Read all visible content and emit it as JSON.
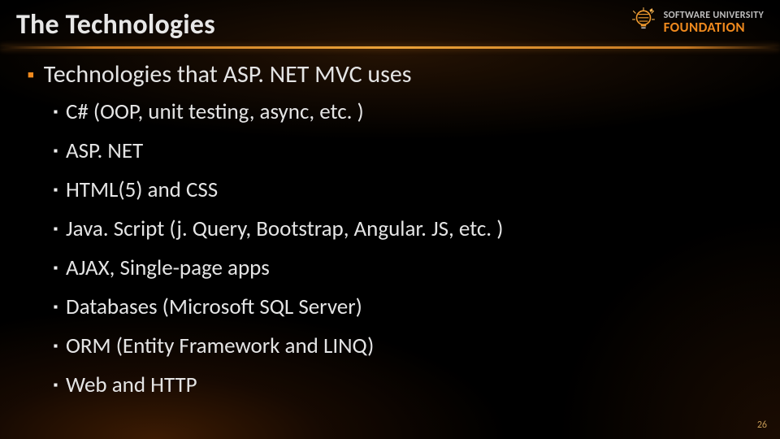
{
  "title": "The Technologies",
  "logo": {
    "line1": "SOFTWARE UNIVERSITY",
    "line2": "FOUNDATION"
  },
  "main_bullet": {
    "text": "Technologies that ASP. NET MVC uses"
  },
  "sub_bullets": [
    {
      "text": "C# (OOP, unit testing, async, etc. )"
    },
    {
      "text": "ASP. NET"
    },
    {
      "text": "HTML(5) and CSS"
    },
    {
      "text": "Java. Script (j. Query, Bootstrap, Angular. JS, etc. )"
    },
    {
      "text": "AJAX, Single-page apps"
    },
    {
      "text": "Databases (Microsoft SQL Server)"
    },
    {
      "text": "ORM (Entity Framework and LINQ)"
    },
    {
      "text": "Web and HTTP"
    }
  ],
  "page_number": "26",
  "colors": {
    "accent": "#f08a1e",
    "text": "#e4e4e4",
    "background": "#000000"
  }
}
